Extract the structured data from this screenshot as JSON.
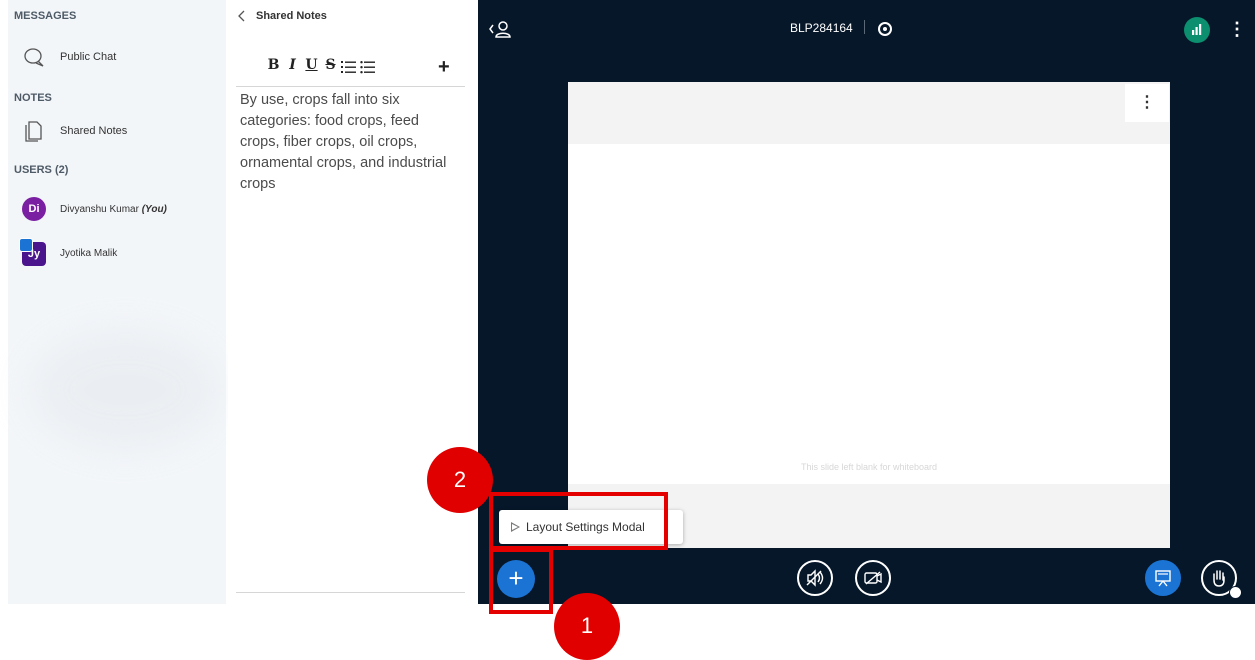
{
  "sidebar": {
    "messages_title": "MESSAGES",
    "public_chat_label": "Public Chat",
    "notes_title": "NOTES",
    "shared_notes_label": "Shared Notes",
    "users_title": "USERS (2)",
    "users": [
      {
        "initials": "Di",
        "name": "Divyanshu Kumar",
        "tag": "(You)",
        "color": "#7b1fa2"
      },
      {
        "initials": "Jy",
        "name": "Jyotika Malik",
        "tag": "",
        "color": "#4a148c"
      }
    ]
  },
  "notes_panel": {
    "title": "Shared Notes",
    "toolbar": [
      "B",
      "I",
      "U",
      "S",
      "ordered-list-icon",
      "bullet-list-icon",
      "plus-icon"
    ],
    "content": "By use, crops fall into six categories: food crops, feed crops, fiber crops, oil crops, ornamental crops, and industrial crops"
  },
  "main": {
    "meeting_title": "BLP284164",
    "slide_caption": "This slide left blank for whiteboard",
    "popover_label": "Layout Settings Modal",
    "colors": {
      "background": "#06172a",
      "accent": "#1b74d4",
      "connection": "#0b8f6e"
    }
  },
  "annotations": {
    "callout_1": "1",
    "callout_2": "2",
    "highlight_color": "#e50000"
  }
}
